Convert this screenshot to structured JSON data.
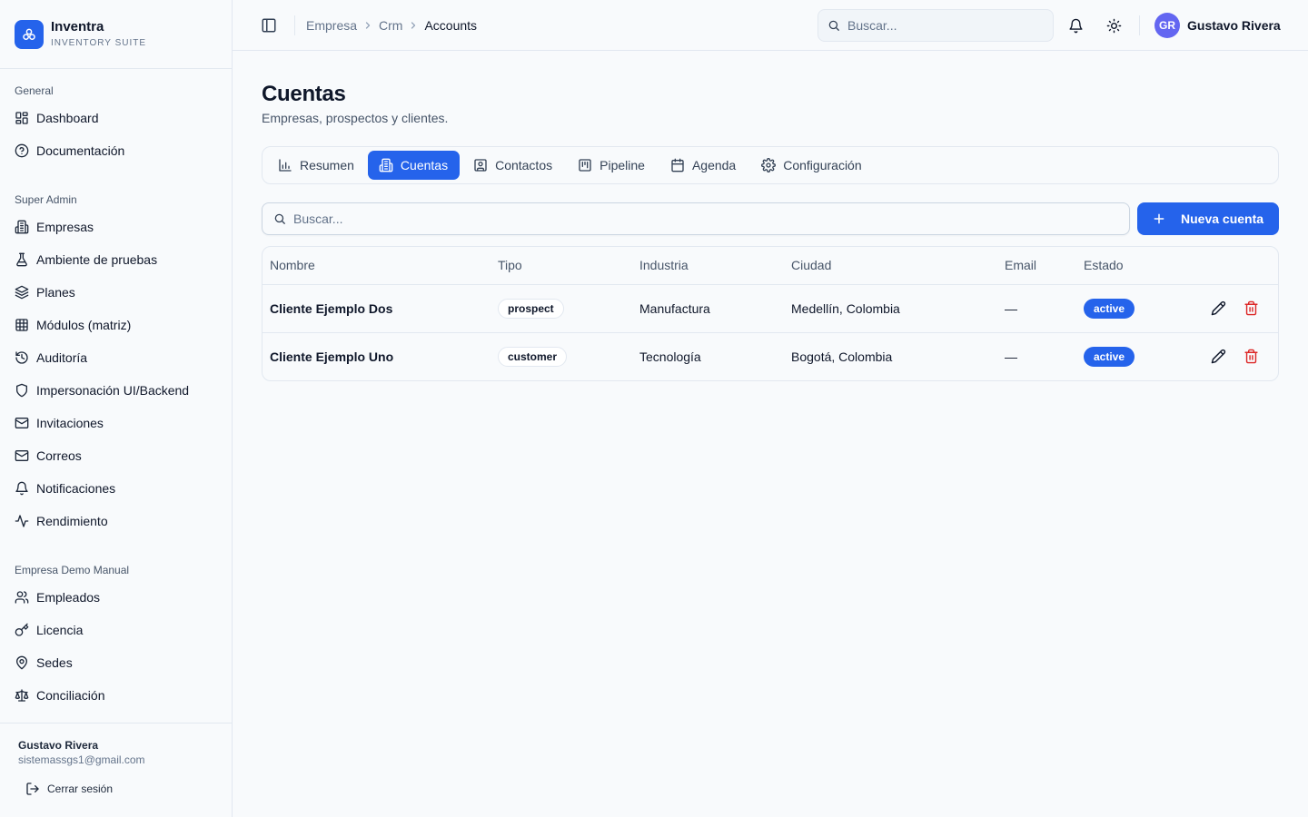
{
  "brand": {
    "name": "Inventra",
    "subtitle": "INVENTORY SUITE"
  },
  "sidebar": {
    "groups": [
      {
        "label": "General",
        "items": [
          {
            "label": "Dashboard",
            "icon": "dashboard-icon"
          },
          {
            "label": "Documentación",
            "icon": "help-circle-icon"
          }
        ]
      },
      {
        "label": "Super Admin",
        "items": [
          {
            "label": "Empresas",
            "icon": "building-icon"
          },
          {
            "label": "Ambiente de pruebas",
            "icon": "flask-icon"
          },
          {
            "label": "Planes",
            "icon": "layers-icon"
          },
          {
            "label": "Módulos (matriz)",
            "icon": "grid-icon"
          },
          {
            "label": "Auditoría",
            "icon": "history-icon"
          },
          {
            "label": "Impersonación UI/Backend",
            "icon": "shield-icon"
          },
          {
            "label": "Invitaciones",
            "icon": "mail-icon"
          },
          {
            "label": "Correos",
            "icon": "mail-icon"
          },
          {
            "label": "Notificaciones",
            "icon": "bell-icon"
          },
          {
            "label": "Rendimiento",
            "icon": "activity-icon"
          }
        ]
      },
      {
        "label": "Empresa Demo Manual",
        "items": [
          {
            "label": "Empleados",
            "icon": "users-icon"
          },
          {
            "label": "Licencia",
            "icon": "key-icon"
          },
          {
            "label": "Sedes",
            "icon": "map-pin-icon"
          },
          {
            "label": "Conciliación",
            "icon": "scale-icon"
          }
        ]
      }
    ],
    "footer": {
      "name": "Gustavo Rivera",
      "email": "sistemassgs1@gmail.com",
      "logout_label": "Cerrar sesión"
    }
  },
  "header": {
    "breadcrumb": [
      "Empresa",
      "Crm",
      "Accounts"
    ],
    "search_placeholder": "Buscar...",
    "user": {
      "initials": "GR",
      "name": "Gustavo Rivera"
    }
  },
  "page": {
    "title": "Cuentas",
    "subtitle": "Empresas, prospectos y clientes.",
    "tabs": [
      {
        "label": "Resumen",
        "icon": "bar-chart-icon",
        "active": false
      },
      {
        "label": "Cuentas",
        "icon": "building-icon",
        "active": true
      },
      {
        "label": "Contactos",
        "icon": "contact-icon",
        "active": false
      },
      {
        "label": "Pipeline",
        "icon": "kanban-icon",
        "active": false
      },
      {
        "label": "Agenda",
        "icon": "calendar-icon",
        "active": false
      },
      {
        "label": "Configuración",
        "icon": "gear-icon",
        "active": false
      }
    ],
    "search_placeholder": "Buscar...",
    "new_button_label": "Nueva cuenta",
    "table": {
      "columns": [
        "Nombre",
        "Tipo",
        "Industria",
        "Ciudad",
        "Email",
        "Estado"
      ],
      "rows": [
        {
          "name": "Cliente Ejemplo Dos",
          "type": "prospect",
          "industry": "Manufactura",
          "city": "Medellín, Colombia",
          "email": "—",
          "status": "active"
        },
        {
          "name": "Cliente Ejemplo Uno",
          "type": "customer",
          "industry": "Tecnología",
          "city": "Bogotá, Colombia",
          "email": "—",
          "status": "active"
        }
      ]
    }
  },
  "colors": {
    "accent": "#2563eb",
    "danger": "#dc2626",
    "avatar": "#6366f1",
    "border": "#e2e8f0"
  }
}
